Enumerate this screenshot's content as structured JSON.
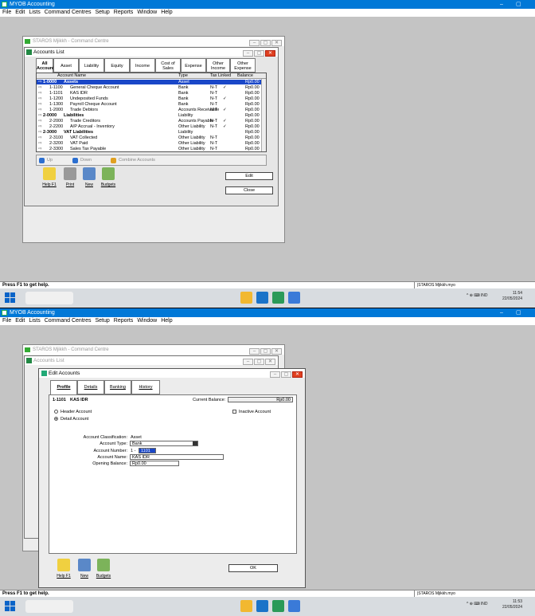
{
  "app": {
    "title": "MYOB Accounting",
    "menu": [
      "File",
      "Edit",
      "Lists",
      "Command Centres",
      "Setup",
      "Reports",
      "Window",
      "Help"
    ],
    "status_text": "Press F1 to get help.",
    "status_file": "|STAROS Mjikkh.myo",
    "window_minimize": "–",
    "window_restore": "▢",
    "window_close": "✕"
  },
  "taskbar": {
    "tray": "^  ⊕  ⌨  IND",
    "clock1_time": "11:54",
    "clock1_date": "22/05/2024",
    "clock2_time": "11:53",
    "clock2_date": "22/05/2024"
  },
  "command_centre": {
    "title": "STAROS Mjikkh - Command Centre"
  },
  "accounts_list": {
    "title": "Accounts List",
    "tabs": [
      {
        "label": "All Accounts"
      },
      {
        "label": "Asset"
      },
      {
        "label": "Liability"
      },
      {
        "label": "Equity"
      },
      {
        "label": "Income"
      },
      {
        "label": "Cost of Sales"
      },
      {
        "label": "Expense"
      },
      {
        "label": "Other Income"
      },
      {
        "label": "Other Expense"
      }
    ],
    "columns": {
      "name": "Account Name",
      "type": "Type",
      "tax": "Tax",
      "linked": "Linked",
      "balance": "Balance"
    },
    "rows": [
      {
        "num": "1-0000",
        "name": "Assets",
        "type": "Asset",
        "tax": "",
        "linked": "",
        "balance": "Rp0.00",
        "header": true,
        "selected": true
      },
      {
        "num": "1-1100",
        "name": "General Cheque Account",
        "type": "Bank",
        "tax": "N-T",
        "linked": "✓",
        "balance": "Rp0.00"
      },
      {
        "num": "1-1101",
        "name": "KAS IDR",
        "type": "Bank",
        "tax": "N-T",
        "linked": "",
        "balance": "Rp0.00"
      },
      {
        "num": "1-1200",
        "name": "Undeposited Funds",
        "type": "Bank",
        "tax": "N-T",
        "linked": "✓",
        "balance": "Rp0.00"
      },
      {
        "num": "1-1300",
        "name": "Payroll Cheque Account",
        "type": "Bank",
        "tax": "N-T",
        "linked": "",
        "balance": "Rp0.00"
      },
      {
        "num": "1-2000",
        "name": "Trade Debtors",
        "type": "Accounts Receivable",
        "tax": "N-T",
        "linked": "✓",
        "balance": "Rp0.00"
      },
      {
        "num": "2-0000",
        "name": "Liabilities",
        "type": "Liability",
        "tax": "",
        "linked": "",
        "balance": "Rp0.00",
        "header": true
      },
      {
        "num": "2-2000",
        "name": "Trade Creditors",
        "type": "Accounts Payable",
        "tax": "N-T",
        "linked": "✓",
        "balance": "Rp0.00"
      },
      {
        "num": "2-2200",
        "name": "A/P Accrual - Inventory",
        "type": "Other Liability",
        "tax": "N-T",
        "linked": "✓",
        "balance": "Rp0.00"
      },
      {
        "num": "2-3000",
        "name": "VAT Liabilities",
        "type": "Liability",
        "tax": "",
        "linked": "",
        "balance": "Rp0.00",
        "header": true
      },
      {
        "num": "2-3100",
        "name": "VAT Collected",
        "type": "Other Liability",
        "tax": "N-T",
        "linked": "",
        "balance": "Rp0.00"
      },
      {
        "num": "2-3200",
        "name": "VAT Paid",
        "type": "Other Liability",
        "tax": "N-T",
        "linked": "",
        "balance": "Rp0.00"
      },
      {
        "num": "2-3300",
        "name": "Sales Tax Payable",
        "type": "Other Liability",
        "tax": "N-T",
        "linked": "",
        "balance": "Rp0.00"
      }
    ],
    "up_label": "Up",
    "down_label": "Down",
    "combine_label": "Combine Accounts",
    "tools": [
      "Help F1",
      "Print",
      "New",
      "Budgets"
    ],
    "edit_label": "Edit",
    "close_label": "Close"
  },
  "edit_account": {
    "title": "Edit Accounts",
    "tabs": [
      "Profile",
      "Details",
      "Banking",
      "History"
    ],
    "account_id": "1-1101",
    "account_label": "KAS IDR",
    "current_balance_label": "Current Balance:",
    "current_balance_value": "Rp0.00",
    "header_account_label": "Header Account",
    "detail_account_label": "Detail Account",
    "inactive_label": "Inactive Account",
    "classification_label": "Account Classification:",
    "classification_value": "Asset",
    "type_label": "Account Type:",
    "type_value": "Bank",
    "number_label": "Account Number:",
    "number_prefix": "1 -",
    "number_value": "1101",
    "name_label": "Account Name:",
    "name_value": "KAS IDR",
    "opening_label": "Opening Balance:",
    "opening_value": "Rp0.00",
    "tools": [
      "Help F1",
      "New",
      "Budgets"
    ],
    "ok_label": "OK"
  }
}
